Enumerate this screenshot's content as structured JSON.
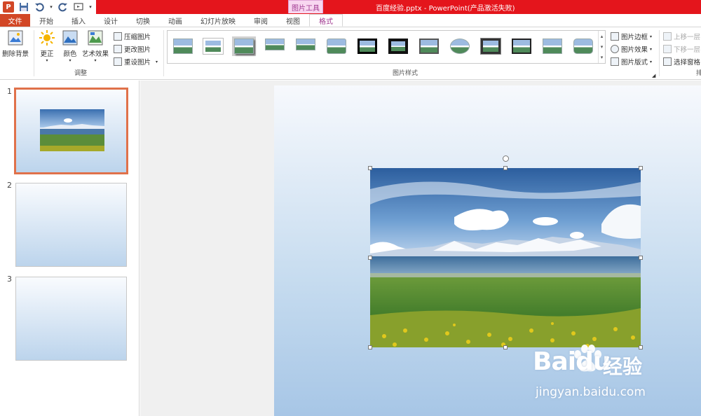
{
  "titlebar": {
    "tools_label": "图片工具",
    "doc_title": "百度经验.pptx - PowerPoint(产品激活失败)",
    "accent_color": "#e4151c"
  },
  "tabs": [
    {
      "label": "文件"
    },
    {
      "label": "开始"
    },
    {
      "label": "插入"
    },
    {
      "label": "设计"
    },
    {
      "label": "切换"
    },
    {
      "label": "动画"
    },
    {
      "label": "幻灯片放映"
    },
    {
      "label": "审阅"
    },
    {
      "label": "视图"
    },
    {
      "label": "格式"
    }
  ],
  "ribbon": {
    "adjust": {
      "remove_bg": "删除背景",
      "corrections": "更正",
      "color": "颜色",
      "artistic": "艺术效果",
      "compress": "压缩图片",
      "change": "更改图片",
      "reset": "重设图片",
      "group_label": "调整"
    },
    "styles": {
      "group_label": "图片样式",
      "border": "图片边框",
      "effects": "图片效果",
      "layout": "图片版式"
    },
    "arrange": {
      "bring_forward": "上移一层",
      "send_backward": "下移一层",
      "selection_pane": "选择窗格",
      "group_label_partial": "排"
    }
  },
  "slides": [
    {
      "number": "1"
    },
    {
      "number": "2"
    },
    {
      "number": "3"
    }
  ],
  "watermark": {
    "brand": "Baidu",
    "product": "经验",
    "url": "jingyan.baidu.com"
  }
}
